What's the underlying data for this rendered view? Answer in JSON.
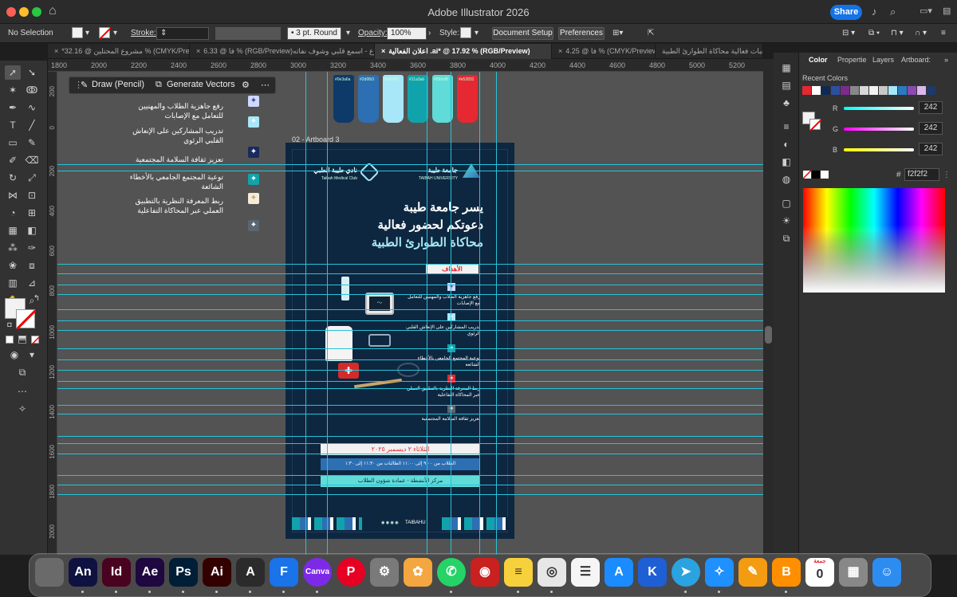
{
  "window": {
    "title": "Adobe Illustrator 2026",
    "share_label": "Share"
  },
  "control_bar": {
    "selection": "No Selection",
    "stroke_label": "Stroke:",
    "brush_value": "3 pt. Round",
    "opacity_label": "Opacity:",
    "opacity_value": "100%",
    "style_label": "Style:",
    "document_setup": "Document Setup",
    "preferences": "Preferences"
  },
  "tabs": [
    {
      "label": "*مشروع المحتلين @ 32.16 % (CMYK/Preview)",
      "active": false
    },
    {
      "label": "فا @ 6.33 % (RGB/Preview)مشروع - اسمع قلبي وشوف نفاثه",
      "active": false
    },
    {
      "label": "اعلان الفعالية .ai* @ 17.92 % (RGB/Preview)",
      "active": true
    },
    {
      "label": "فا @ 4.25 % (CMYK/Preview)",
      "active": false
    },
    {
      "label": "مكعبات فعالية محاكاة الطوارئ الطبية",
      "active": false
    }
  ],
  "ruler": {
    "h_ticks": [
      "1800",
      "2000",
      "2200",
      "2400",
      "2600",
      "2800",
      "3000",
      "3200",
      "3400",
      "3600",
      "3800",
      "4000",
      "4200",
      "4400",
      "4600",
      "4800",
      "5000",
      "5200"
    ],
    "v_ticks": [
      "200",
      "0",
      "200",
      "400",
      "600",
      "800",
      "1000",
      "1200",
      "1400",
      "1600",
      "1800",
      "2000"
    ]
  },
  "contextual_bar": {
    "draw_label": "Draw (Pencil)",
    "generate_label": "Generate Vectors"
  },
  "side_notes": [
    "رفع جاهزية الطلاب والمهنيين للتعامل مع الإصابات",
    "تدريب المشاركين على الإنعاش القلبي الرئوي",
    "تعزيز ثقافة السلامة المجتمعية",
    "توعية المجتمع الجامعي بالأخطاء الشائعة",
    "ربط المعرفة النظرية بالتطبيق العملي عبر المحاكاة التفاعلية"
  ],
  "color_strips": [
    {
      "code": "#0e3a6a",
      "color": "#0e3a6a"
    },
    {
      "code": "#2d6fb3",
      "color": "#2d6fb3"
    },
    {
      "code": "#a8e7f7",
      "color": "#a8e7f7"
    },
    {
      "code": "#11a3ab",
      "color": "#11a3ab"
    },
    {
      "code": "#5fdcd8",
      "color": "#5fdcd8"
    },
    {
      "code": "#e52831",
      "color": "#e52831"
    }
  ],
  "artboard": {
    "label": "02 - Artboard 3",
    "club_ar": "نادي طيبة الطبي",
    "club_en": "Taibah Medical Club",
    "uni_ar": "جامعة طيبة",
    "uni_en": "TAIBAH UNIVERSITY",
    "head1": "يسر جامعة طيبة",
    "head2": "دعوتكم لحضور فعالية",
    "head3": "محاكاة الطوارئ الطبية",
    "goals_title": "الأهداف",
    "goals": [
      "رفع جاهزية الطلاب والمهنيين للتعامل مع الإصابات",
      "تدريب المشاركين على الإنعاش القلبي الرئوي",
      "توعية المجتمع الجامعي بالأخطاء الشائعة",
      "ربط المعرفة النظرية بالتطبيق العملي عبر المحاكاة التفاعلية",
      "تعزيز ثقافة السلامة المجتمعية"
    ],
    "date": "الثلاثاء ٢ ديسمبر ٢٠٢٥",
    "times": "الطلاب من ٩:٠٠ إلى ١١:٠٠    الطالبات من ١١:٣٠ إلى ١:٣٠",
    "venue": "مركز الأنشطة - عمادة شؤون الطلاب",
    "social": "TAIBAHU"
  },
  "right_panel": {
    "tabs": [
      "Color",
      "Propertie",
      "Layers",
      "Artboard:"
    ],
    "recent_label": "Recent Colors",
    "recent": [
      "#e52831",
      "#ffffff",
      "#0e2a52",
      "#2d4fa0",
      "#7a2c8c",
      "#888888",
      "#d8d8d8",
      "#f2f2f2",
      "#c8c8c8",
      "#a8e7f7",
      "#2a7ac0",
      "#8a4ab0",
      "#d9b8ec",
      "#1d3a6a"
    ],
    "r_label": "R",
    "g_label": "G",
    "b_label": "B",
    "r": "242",
    "g": "242",
    "b": "242",
    "hex": "f2f2f2",
    "hash": "#"
  },
  "dock": [
    {
      "name": "trash",
      "label": "",
      "color": "#6a6a6a"
    },
    {
      "name": "animate",
      "label": "An",
      "color": "#0f1240"
    },
    {
      "name": "indesign",
      "label": "Id",
      "color": "#49021f"
    },
    {
      "name": "after-effects",
      "label": "Ae",
      "color": "#1f0740"
    },
    {
      "name": "photoshop",
      "label": "Ps",
      "color": "#001e36"
    },
    {
      "name": "illustrator",
      "label": "Ai",
      "color": "#330000"
    },
    {
      "name": "app-a",
      "label": "A",
      "color": "#2b2b2b"
    },
    {
      "name": "framer",
      "label": "F",
      "color": "#1a73e8"
    },
    {
      "name": "canva",
      "label": "Canva",
      "color": "#7d2ae8"
    },
    {
      "name": "pinterest",
      "label": "P",
      "color": "#e60023"
    },
    {
      "name": "settings",
      "label": "⚙",
      "color": "#7a7a7a"
    },
    {
      "name": "photos",
      "label": "✿",
      "color": "#f4a640"
    },
    {
      "name": "whatsapp",
      "label": "✆",
      "color": "#25d366"
    },
    {
      "name": "photo-booth",
      "label": "◉",
      "color": "#c92020"
    },
    {
      "name": "notes",
      "label": "≡",
      "color": "#f7d13b"
    },
    {
      "name": "chrome",
      "label": "◎",
      "color": "#e6e6e6"
    },
    {
      "name": "reminders",
      "label": "☰",
      "color": "#f5f5f5"
    },
    {
      "name": "app-store",
      "label": "A",
      "color": "#1a8cff"
    },
    {
      "name": "keynote",
      "label": "K",
      "color": "#1f5fd6"
    },
    {
      "name": "telegram",
      "label": "➤",
      "color": "#2aa3e0"
    },
    {
      "name": "safari",
      "label": "✧",
      "color": "#1e90ff"
    },
    {
      "name": "pages",
      "label": "✎",
      "color": "#f39c12"
    },
    {
      "name": "books",
      "label": "B",
      "color": "#ff8f00"
    },
    {
      "name": "calendar",
      "label": "0",
      "color": "#ffffff"
    },
    {
      "name": "launchpad",
      "label": "▦",
      "color": "#888"
    },
    {
      "name": "finder",
      "label": "☺",
      "color": "#2d8cf0"
    }
  ],
  "calendar_top": "جمعة"
}
